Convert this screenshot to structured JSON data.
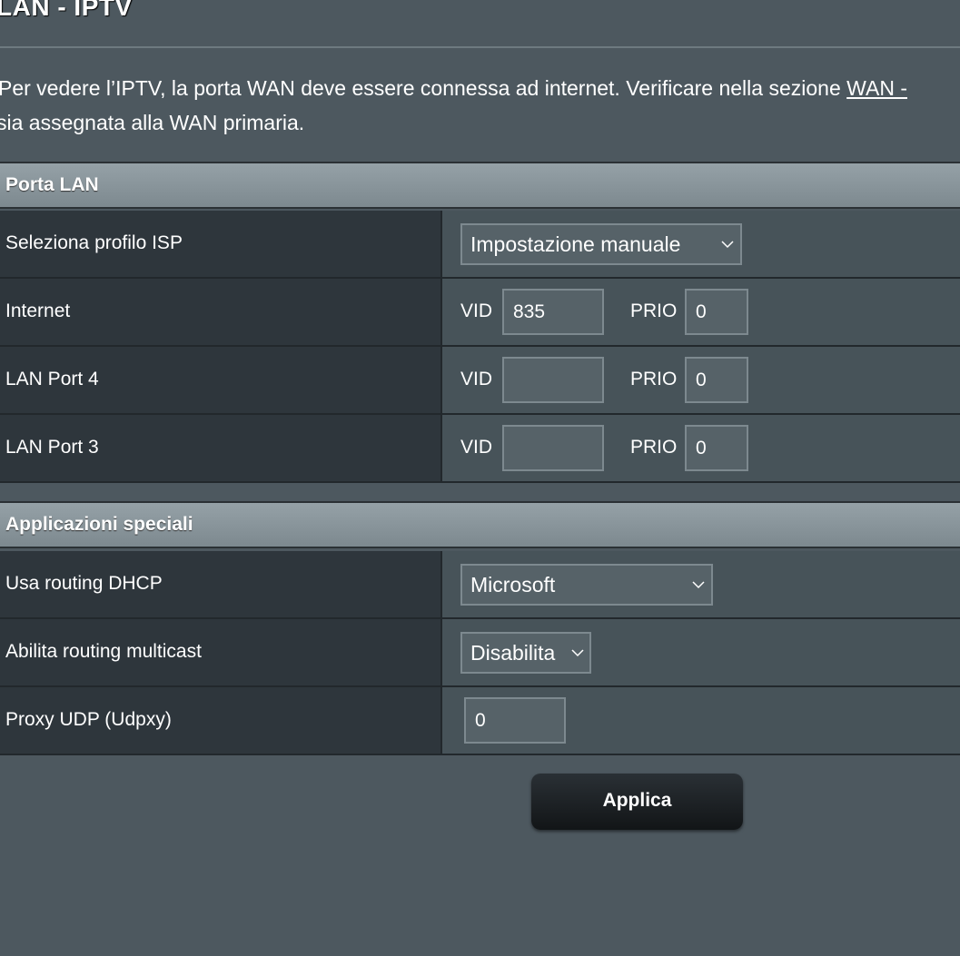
{
  "header": {
    "title": "LAN - IPTV"
  },
  "notice": {
    "line1_text": "Per vedere l’IPTV, la porta WAN deve essere connessa ad internet. Verificare nella sezione ",
    "line1_link": "WAN -",
    "line2_text": "sia assegnata alla WAN primaria."
  },
  "porta_lan": {
    "section_title": "Porta LAN",
    "isp_profile": {
      "label": "Seleziona profilo ISP",
      "value": "Impostazione manuale"
    },
    "internet": {
      "label": "Internet",
      "vid_label": "VID",
      "vid_value": "835",
      "prio_label": "PRIO",
      "prio_value": "0"
    },
    "lan_port_4": {
      "label": "LAN Port 4",
      "vid_label": "VID",
      "vid_value": "",
      "prio_label": "PRIO",
      "prio_value": "0"
    },
    "lan_port_3": {
      "label": "LAN Port 3",
      "vid_label": "VID",
      "vid_value": "",
      "prio_label": "PRIO",
      "prio_value": "0"
    }
  },
  "applicazioni_speciali": {
    "section_title": "Applicazioni speciali",
    "dhcp_routing": {
      "label": "Usa routing DHCP",
      "value": "Microsoft"
    },
    "multicast_routing": {
      "label": "Abilita routing multicast",
      "value": "Disabilita"
    },
    "udp_proxy": {
      "label": "Proxy UDP (Udpxy)",
      "value": "0"
    }
  },
  "actions": {
    "apply_label": "Applica"
  }
}
